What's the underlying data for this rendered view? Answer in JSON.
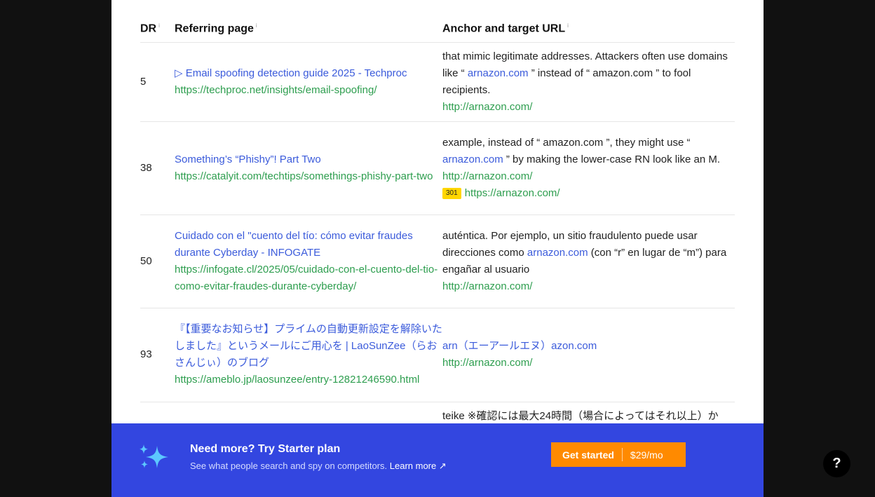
{
  "table": {
    "headers": {
      "dr": "DR",
      "referring_page": "Referring page",
      "anchor_target": "Anchor and target URL",
      "info_glyph": "i"
    },
    "rows": [
      {
        "dr": "5",
        "ref_title": "▷ Email spoofing detection guide 2025 - Techproc",
        "ref_url": "https://techproc.net/insights/email-spoofing/",
        "anchor_before": "that mimic legitimate addresses. Attackers often use domains like “ ",
        "anchor_link": "arnazon.com",
        "anchor_after": " ” instead of “ amazon.com ” to fool recipients.",
        "target_url": "http://arnazon.com/"
      },
      {
        "dr": "38",
        "ref_title": "Something’s “Phishy”! Part Two",
        "ref_url": "https://catalyit.com/techtips/somethings-phishy-part-two",
        "anchor_before": "example, instead of “ amazon.com ”, they might use “ ",
        "anchor_link": "arnazon.com",
        "anchor_after": " ” by making the lower-case RN look like an M.",
        "target_url": "http://arnazon.com/",
        "redirect_code": "301",
        "redirect_url": "https://arnazon.com/"
      },
      {
        "dr": "50",
        "ref_title": "Cuidado con el \"cuento del tío: cómo evitar fraudes durante Cyberday - INFOGATE",
        "ref_url": "https://infogate.cl/2025/05/cuidado-con-el-cuento-del-tio-como-evitar-fraudes-durante-cyberday/",
        "anchor_before": "auténtica. Por ejemplo, un sitio fraudulento puede usar direcciones como ",
        "anchor_link": "arnazon.com",
        "anchor_after": " (con “r” en lugar de “m”) para engañar al usuario",
        "target_url": "http://arnazon.com/"
      },
      {
        "dr": "93",
        "ref_title": "『【重要なお知らせ】プライムの自動更新設定を解除いたしました』というメールにご用心を | LaoSunZee（らおさんじぃ）のブログ",
        "ref_url": "https://ameblo.jp/laosunzee/entry-12821246590.html",
        "anchor_before": "",
        "anchor_link": "arn（エーアールエヌ）azon.com",
        "anchor_after": "",
        "target_url": "http://arnazon.com/"
      },
      {
        "dr": "",
        "ref_title": "",
        "ref_url": "",
        "anchor_before": "teike ※確認には最大24時間（場合によってはそれ以上）か",
        "anchor_link": "",
        "anchor_after": "",
        "target_url": ""
      }
    ]
  },
  "banner": {
    "title": "Need more? Try Starter plan",
    "subtitle": "See what people search and spy on competitors.",
    "learn_more": "Learn more ↗",
    "cta_label": "Get started",
    "cta_price": "$29/mo",
    "icon": "sparkles-icon"
  },
  "help": {
    "label": "?",
    "icon": "help-icon"
  },
  "colors": {
    "banner": "#3346e0",
    "cta": "#ff8a00",
    "link": "#3b5bdb",
    "url": "#2e9e4f",
    "badge": "#ffd600",
    "backdrop": "#111111"
  }
}
